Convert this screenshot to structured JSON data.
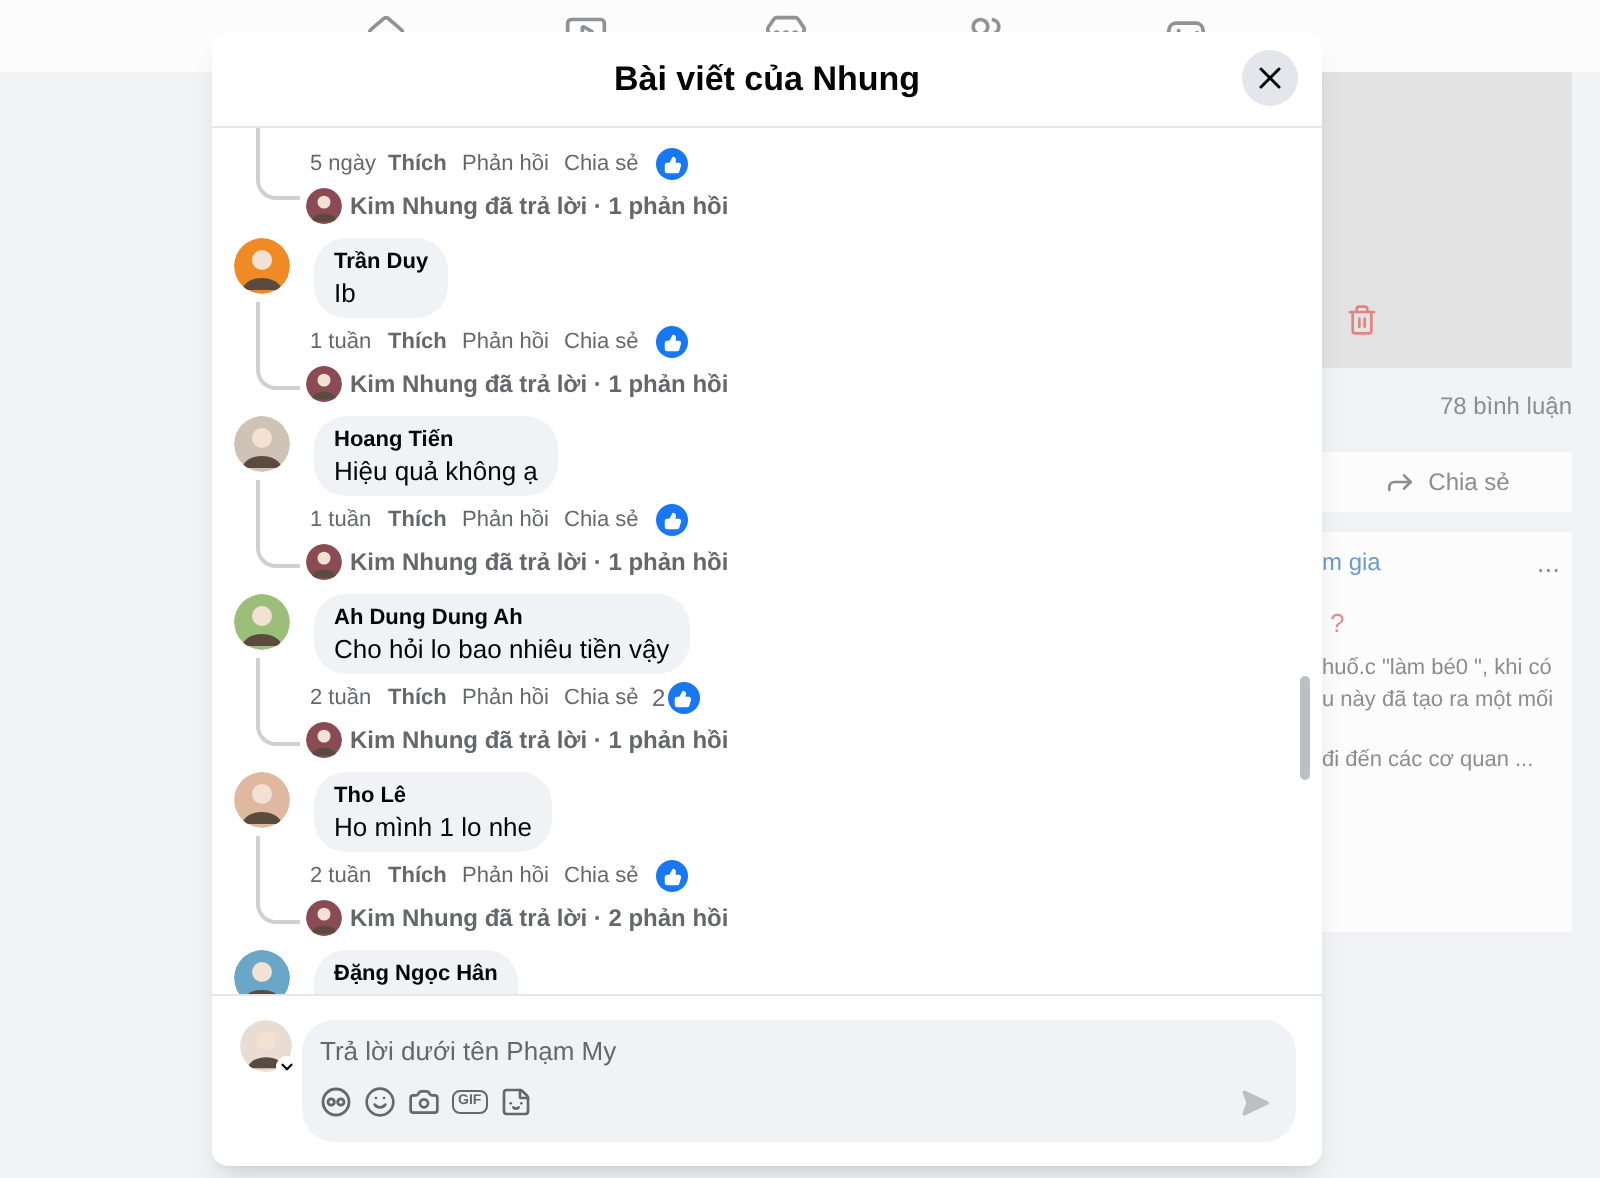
{
  "background_page": {
    "comment_count": "78 bình luận",
    "share_label": "Chia sẻ",
    "card_heading": "m gia",
    "more": "...",
    "card_mark": "?",
    "card_lines": [
      "huố.c \"làm bé0 \", khi có",
      "u này đã tạo ra một mối",
      "đi đến các cơ quan ..."
    ]
  },
  "dialog": {
    "title": "Bài viết của Nhung"
  },
  "comments": [
    {
      "kind": "actions_only",
      "time": "5 ngày",
      "like": "Thích",
      "reply": "Phản hồi",
      "share": "Chia sẻ",
      "reply_summary": "Kim Nhung đã trả lời · 1 phản hồi"
    },
    {
      "kind": "full",
      "author": "Trần Duy",
      "text": "Ib",
      "time": "1 tuần",
      "like": "Thích",
      "reply": "Phản hồi",
      "share": "Chia sẻ",
      "reply_summary": "Kim Nhung đã trả lời · 1 phản hồi"
    },
    {
      "kind": "full",
      "author": "Hoang Tiến",
      "text": "Hiệu quả không ạ",
      "time": "1 tuần",
      "like": "Thích",
      "reply": "Phản hồi",
      "share": "Chia sẻ",
      "reply_summary": "Kim Nhung đã trả lời · 1 phản hồi"
    },
    {
      "kind": "full",
      "author": "Ah Dung Dung Ah",
      "text": "Cho hỏi lo bao nhiêu tiền vậy",
      "time": "2 tuần",
      "like": "Thích",
      "reply": "Phản hồi",
      "share": "Chia sẻ",
      "like_count": "2",
      "reply_summary": "Kim Nhung đã trả lời · 1 phản hồi"
    },
    {
      "kind": "full",
      "author": "Tho Lê",
      "text": "Ho mình 1 lo nhe",
      "time": "2 tuần",
      "like": "Thích",
      "reply": "Phản hồi",
      "share": "Chia sẻ",
      "reply_summary": "Kim Nhung đã trả lời · 2 phản hồi"
    },
    {
      "kind": "name_only",
      "author": "Đặng Ngọc Hân"
    }
  ],
  "composer": {
    "placeholder": "Trả lời dưới tên Phạm My",
    "gif_label": "GIF"
  }
}
